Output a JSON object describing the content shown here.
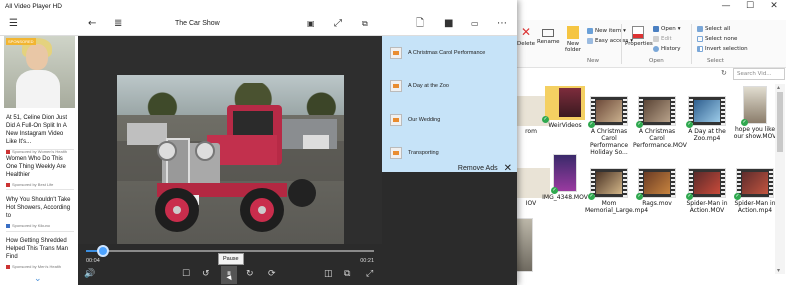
{
  "window": {
    "title": "All Video Player HD"
  },
  "appbar": {
    "title": "The Car Show"
  },
  "ads": {
    "items": [
      {
        "headline": "At 51, Celine Dion Just Did A Full-On Split In A New Instagram Video Like It's...",
        "sponsor": "Sponsored by Women's Health"
      },
      {
        "headline": "Women Who Do This One Thing Weekly Are Healthier",
        "sponsor": "Sponsored by Best Life"
      },
      {
        "headline": "Why You Shouldn't Take Hot Showers, According to",
        "sponsor": "Sponsored by Kikuno"
      },
      {
        "headline": "How Getting Shredded Helped This Trans Man Find",
        "sponsor": "Sponsored by Men's Health"
      }
    ],
    "photo_badge": "SPONSORED"
  },
  "player": {
    "current_time": "00:04",
    "duration": "00:21",
    "progress": 0.06,
    "tooltip": "Pause"
  },
  "playlist": {
    "items": [
      "A Christmas Carol Performance",
      "A Day at the Zoo",
      "Our Wedding",
      "Transporting"
    ],
    "remove_ads": "Remove Ads"
  },
  "explorer": {
    "window_controls": [
      "—",
      "☐",
      "✕"
    ],
    "ribbon": {
      "delete": "Delete",
      "rename": "Rename",
      "new_folder": "New folder",
      "new_item": "New item",
      "easy_access": "Easy access",
      "properties": "Properties",
      "open": "Open",
      "edit": "Edit",
      "history": "History",
      "select_all": "Select all",
      "select_none": "Select none",
      "invert_selection": "Invert selection",
      "group_new": "New",
      "group_open": "Open",
      "group_select": "Select"
    },
    "search_placeholder": "Search Vid...",
    "files": [
      {
        "name": "rom",
        "kind": "partial"
      },
      {
        "name": "WeirVideos",
        "kind": "folder"
      },
      {
        "name": "A Christmas Carol Performance Holiday So...",
        "kind": "video"
      },
      {
        "name": "A Christmas Carol Performance.MOV",
        "kind": "video"
      },
      {
        "name": "A Day at the Zoo.mp4",
        "kind": "video"
      },
      {
        "name": "hope you like our show.MOV",
        "kind": "video"
      },
      {
        "name": "IOV",
        "kind": "partial"
      },
      {
        "name": "IMG_4348.MOV",
        "kind": "video"
      },
      {
        "name": "Mom Memorial_Large.mp4",
        "kind": "video"
      },
      {
        "name": "Rags.mov",
        "kind": "video"
      },
      {
        "name": "Spider-Man in Action.MOV",
        "kind": "video"
      },
      {
        "name": "Spider-Man in Action.mp4",
        "kind": "video"
      }
    ]
  }
}
